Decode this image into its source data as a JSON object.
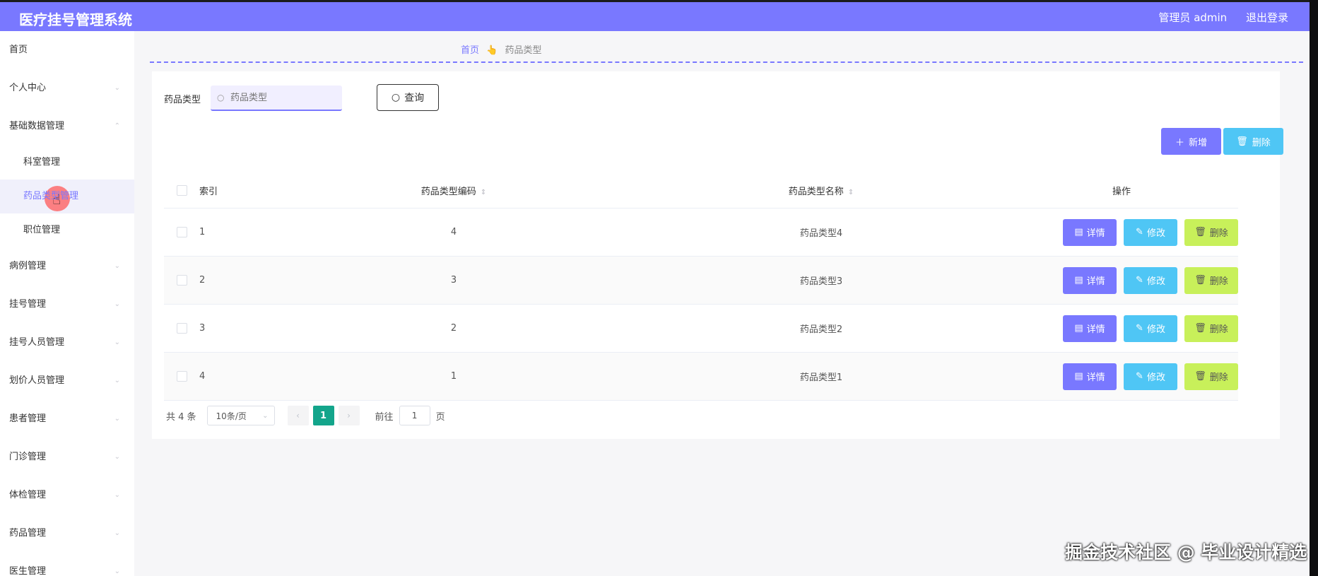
{
  "header": {
    "app_title": "医疗挂号管理系统",
    "user_label": "管理员 admin",
    "logout_label": "退出登录"
  },
  "sidebar": {
    "items": [
      {
        "label": "首页"
      },
      {
        "label": "个人中心"
      },
      {
        "label": "基础数据管理"
      },
      {
        "label": "科室管理"
      },
      {
        "label": "药品类型管理"
      },
      {
        "label": "职位管理"
      },
      {
        "label": "病例管理"
      },
      {
        "label": "挂号管理"
      },
      {
        "label": "挂号人员管理"
      },
      {
        "label": "划价人员管理"
      },
      {
        "label": "患者管理"
      },
      {
        "label": "门诊管理"
      },
      {
        "label": "体检管理"
      },
      {
        "label": "药品管理"
      },
      {
        "label": "医生管理"
      }
    ],
    "active_item": "药品类型管理"
  },
  "breadcrumb": {
    "home": "首页",
    "current": "药品类型"
  },
  "search": {
    "label": "药品类型",
    "placeholder": "药品类型",
    "query_button": "查询"
  },
  "toolbar": {
    "add_label": "新增",
    "delete_label": "删除"
  },
  "table": {
    "headers": {
      "index": "索引",
      "code": "药品类型编码",
      "name": "药品类型名称",
      "ops": "操作"
    },
    "rows": [
      {
        "index": "1",
        "code": "4",
        "name": "药品类型4"
      },
      {
        "index": "2",
        "code": "3",
        "name": "药品类型3"
      },
      {
        "index": "3",
        "code": "2",
        "name": "药品类型2"
      },
      {
        "index": "4",
        "code": "1",
        "name": "药品类型1"
      }
    ],
    "row_actions": {
      "detail": "详情",
      "edit": "修改",
      "delete": "删除"
    }
  },
  "pagination": {
    "total": "共 4 条",
    "page_size": "10条/页",
    "current_page": "1",
    "goto_prefix": "前往",
    "goto_value": "1",
    "goto_suffix": "页"
  },
  "watermark": "掘金技术社区 @ 毕业设计精选",
  "colors": {
    "accent": "#7978ff",
    "edit": "#4fc6f5",
    "delete": "#c8f05a",
    "page_active": "#13a58b"
  }
}
